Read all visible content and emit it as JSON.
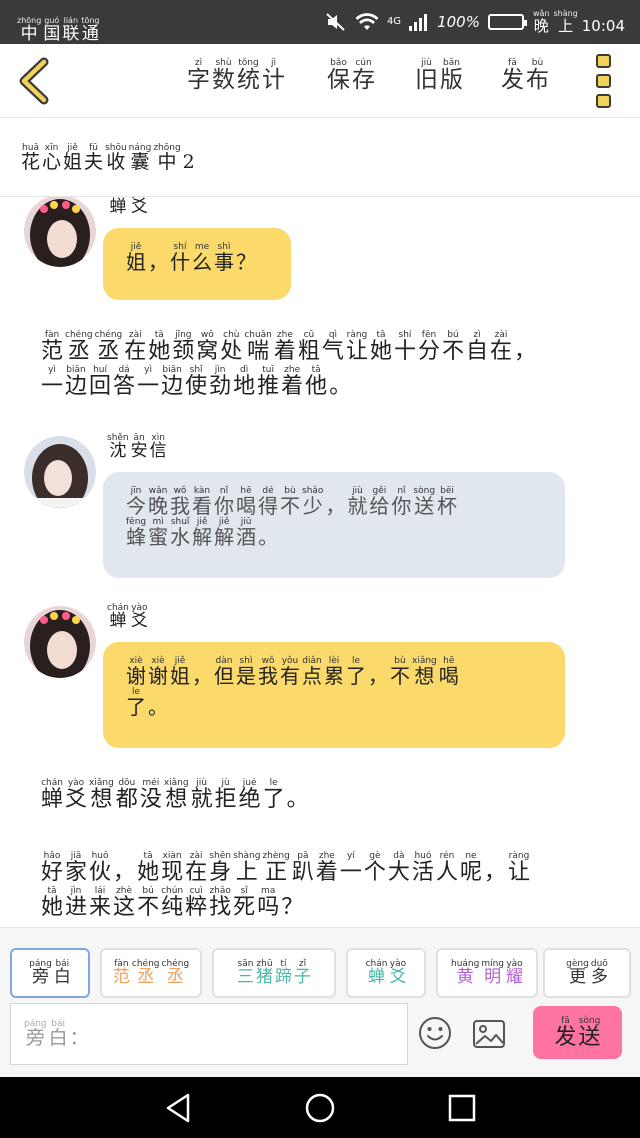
{
  "status_bar": {
    "carrier": [
      [
        "zhōng",
        "中"
      ],
      [
        "guó",
        "国"
      ],
      [
        "lián",
        "联"
      ],
      [
        "tōng",
        "通"
      ]
    ],
    "network": "4G",
    "battery": "100%",
    "clock": [
      [
        "wǎn",
        "晚"
      ],
      [
        "shàng",
        "上"
      ],
      [
        "",
        "10:04"
      ]
    ]
  },
  "toolbar": {
    "back_icon": "chevron-left-icon",
    "word_count": [
      [
        "zì",
        "字"
      ],
      [
        "shù",
        "数"
      ],
      [
        "tǒng",
        "统"
      ],
      [
        "jì",
        "计"
      ]
    ],
    "save": [
      [
        "bǎo",
        "保"
      ],
      [
        "cún",
        "存"
      ]
    ],
    "old_version": [
      [
        "jiù",
        "旧"
      ],
      [
        "bǎn",
        "版"
      ]
    ],
    "publish": [
      [
        "fā",
        "发"
      ],
      [
        "bù",
        "布"
      ]
    ],
    "menu_icon": "menu-icon"
  },
  "title": [
    [
      "huā",
      "花"
    ],
    [
      "xīn",
      "心"
    ],
    [
      "jiě",
      "姐"
    ],
    [
      "fū",
      "夫"
    ],
    [
      "shōu",
      "收"
    ],
    [
      "náng",
      "囊"
    ],
    [
      "zhōng",
      "中"
    ],
    [
      "",
      "2"
    ]
  ],
  "messages": [
    {
      "speaker": [
        [
          "chán",
          "蝉"
        ],
        [
          "yào",
          "爻"
        ]
      ],
      "bubble_color": "#fbd96a",
      "lines": [
        [
          [
            "jiě",
            "姐"
          ],
          [
            "",
            "，"
          ],
          [
            "shí",
            "什"
          ],
          [
            "me",
            "么"
          ],
          [
            "shì",
            "事"
          ],
          [
            "",
            "？"
          ]
        ]
      ]
    },
    {
      "narration": [
        [
          [
            "fàn",
            "范"
          ],
          [
            "chéng",
            "丞"
          ],
          [
            "chéng",
            "丞"
          ],
          [
            "zài",
            "在"
          ],
          [
            "tā",
            "她"
          ],
          [
            "jǐng",
            "颈"
          ],
          [
            "wō",
            "窝"
          ],
          [
            "chù",
            "处"
          ],
          [
            "chuǎn",
            "喘"
          ],
          [
            "zhe",
            "着"
          ],
          [
            "cū",
            "粗"
          ],
          [
            "qì",
            "气"
          ],
          [
            "ràng",
            "让"
          ],
          [
            "tā",
            "她"
          ],
          [
            "shí",
            "十"
          ],
          [
            "fēn",
            "分"
          ],
          [
            "bú",
            "不"
          ],
          [
            "zì",
            "自"
          ],
          [
            "zài",
            "在"
          ],
          [
            "",
            "，"
          ]
        ],
        [
          [
            "yì",
            "一"
          ],
          [
            "biān",
            "边"
          ],
          [
            "huí",
            "回"
          ],
          [
            "dá",
            "答"
          ],
          [
            "yì",
            "一"
          ],
          [
            "biān",
            "边"
          ],
          [
            "shǐ",
            "使"
          ],
          [
            "jìn",
            "劲"
          ],
          [
            "dì",
            "地"
          ],
          [
            "tuī",
            "推"
          ],
          [
            "zhe",
            "着"
          ],
          [
            "tā",
            "他"
          ],
          [
            "",
            "。"
          ]
        ]
      ]
    },
    {
      "speaker": [
        [
          "shěn",
          "沈"
        ],
        [
          "ān",
          "安"
        ],
        [
          "xìn",
          "信"
        ]
      ],
      "bubble_color": "#e1e7ef",
      "lines": [
        [
          [
            "jīn",
            "今"
          ],
          [
            "wǎn",
            "晚"
          ],
          [
            "wǒ",
            "我"
          ],
          [
            "kàn",
            "看"
          ],
          [
            "nǐ",
            "你"
          ],
          [
            "hē",
            "喝"
          ],
          [
            "dé",
            "得"
          ],
          [
            "bù",
            "不"
          ],
          [
            "shǎo",
            "少"
          ],
          [
            "",
            "，"
          ],
          [
            "jiù",
            "就"
          ],
          [
            "gěi",
            "给"
          ],
          [
            "nǐ",
            "你"
          ],
          [
            "sòng",
            "送"
          ],
          [
            "bēi",
            "杯"
          ]
        ],
        [
          [
            "fēng",
            "蜂"
          ],
          [
            "mì",
            "蜜"
          ],
          [
            "shuǐ",
            "水"
          ],
          [
            "jiě",
            "解"
          ],
          [
            "jiě",
            "解"
          ],
          [
            "jiǔ",
            "酒"
          ],
          [
            "",
            "。"
          ]
        ]
      ]
    },
    {
      "speaker": [
        [
          "chán",
          "蝉"
        ],
        [
          "yào",
          "爻"
        ]
      ],
      "bubble_color": "#fbd96a",
      "lines": [
        [
          [
            "xiè",
            "谢"
          ],
          [
            "xiè",
            "谢"
          ],
          [
            "jiě",
            "姐"
          ],
          [
            "",
            "，"
          ],
          [
            "dàn",
            "但"
          ],
          [
            "shì",
            "是"
          ],
          [
            "wǒ",
            "我"
          ],
          [
            "yǒu",
            "有"
          ],
          [
            "diǎn",
            "点"
          ],
          [
            "lèi",
            "累"
          ],
          [
            "le",
            "了"
          ],
          [
            "",
            "，"
          ],
          [
            "bù",
            "不"
          ],
          [
            "xiǎng",
            "想"
          ],
          [
            "hē",
            "喝"
          ]
        ],
        [
          [
            "le",
            "了"
          ],
          [
            "",
            "。"
          ]
        ]
      ]
    },
    {
      "narration": [
        [
          [
            "chán",
            "蝉"
          ],
          [
            "yào",
            "爻"
          ],
          [
            "xiǎng",
            "想"
          ],
          [
            "dōu",
            "都"
          ],
          [
            "méi",
            "没"
          ],
          [
            "xiǎng",
            "想"
          ],
          [
            "jiù",
            "就"
          ],
          [
            "jù",
            "拒"
          ],
          [
            "jué",
            "绝"
          ],
          [
            "le",
            "了"
          ],
          [
            "",
            "。"
          ]
        ]
      ]
    },
    {
      "narration": [
        [
          [
            "hǎo",
            "好"
          ],
          [
            "jiā",
            "家"
          ],
          [
            "huǒ",
            "伙"
          ],
          [
            "",
            "，"
          ],
          [
            "tā",
            "她"
          ],
          [
            "xiàn",
            "现"
          ],
          [
            "zài",
            "在"
          ],
          [
            "shēn",
            "身"
          ],
          [
            "shàng",
            "上"
          ],
          [
            "zhèng",
            "正"
          ],
          [
            "pā",
            "趴"
          ],
          [
            "zhe",
            "着"
          ],
          [
            "yí",
            "一"
          ],
          [
            "gè",
            "个"
          ],
          [
            "dà",
            "大"
          ],
          [
            "huó",
            "活"
          ],
          [
            "rén",
            "人"
          ],
          [
            "ne",
            "呢"
          ],
          [
            "",
            "，"
          ],
          [
            "ràng",
            "让"
          ]
        ],
        [
          [
            "tā",
            "她"
          ],
          [
            "jìn",
            "进"
          ],
          [
            "lái",
            "来"
          ],
          [
            "zhè",
            "这"
          ],
          [
            "bú",
            "不"
          ],
          [
            "chún",
            "纯"
          ],
          [
            "cuì",
            "粹"
          ],
          [
            "zhǎo",
            "找"
          ],
          [
            "sǐ",
            "死"
          ],
          [
            "ma",
            "吗"
          ],
          [
            "",
            "？"
          ]
        ]
      ]
    }
  ],
  "roles": [
    {
      "label": [
        [
          "páng",
          "旁"
        ],
        [
          "bái",
          "白"
        ]
      ],
      "color": "#333333",
      "active": true
    },
    {
      "label": [
        [
          "fàn",
          "范"
        ],
        [
          "chéng",
          "丞"
        ],
        [
          "chéng",
          "丞"
        ]
      ],
      "color": "#f0a05a",
      "active": false
    },
    {
      "label": [
        [
          "sān",
          "三"
        ],
        [
          "zhū",
          "猪"
        ],
        [
          "tí",
          "蹄"
        ],
        [
          "zǐ",
          "子"
        ]
      ],
      "color": "#4ab6a8",
      "active": false
    },
    {
      "label": [
        [
          "chán",
          "蝉"
        ],
        [
          "yào",
          "爻"
        ]
      ],
      "color": "#41b7a6",
      "active": false
    },
    {
      "label": [
        [
          "huáng",
          "黄"
        ],
        [
          "míng",
          "明"
        ],
        [
          "yào",
          "耀"
        ]
      ],
      "color": "#b45fd6",
      "active": false
    },
    {
      "label": [
        [
          "gèng",
          "更"
        ],
        [
          "duō",
          "多"
        ]
      ],
      "color": "#333333",
      "active": false
    }
  ],
  "input": {
    "placeholder": [
      [
        "páng",
        "旁"
      ],
      [
        "bái",
        "白"
      ],
      [
        "",
        "："
      ]
    ]
  },
  "send_button": [
    [
      "fā",
      "发"
    ],
    [
      "sòng",
      "送"
    ]
  ],
  "icons": {
    "emoji": "smiley-icon",
    "image": "image-icon",
    "nav_back": "triangle-back-icon",
    "nav_home": "circle-home-icon",
    "nav_recent": "square-recent-icon"
  }
}
